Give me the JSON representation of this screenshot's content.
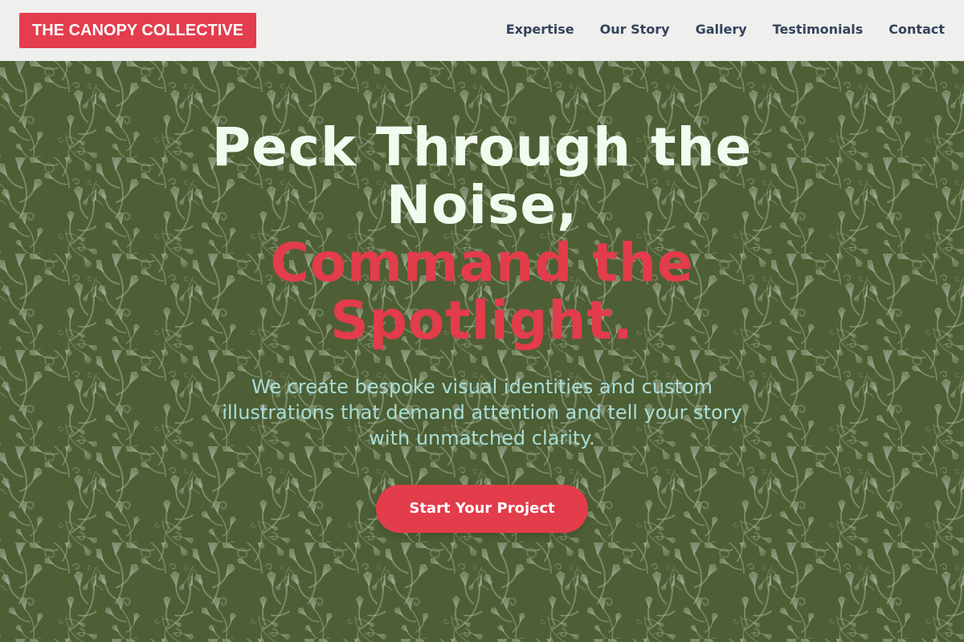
{
  "header": {
    "brand": "THE CANOPY COLLECTIVE",
    "nav": [
      "Expertise",
      "Our Story",
      "Gallery",
      "Testimonials",
      "Contact"
    ]
  },
  "hero": {
    "headline_line1": "Peck Through the",
    "headline_line2": "Noise,",
    "headline_accent_line1": "Command the",
    "headline_accent_line2": "Spotlight.",
    "subtitle": "We create bespoke visual identities and custom illustrations that demand attention and tell your story with unmatched clarity.",
    "cta_label": "Start Your Project",
    "background_icon": "fern-pattern"
  },
  "colors": {
    "accent": "#e43d4d",
    "header_bg": "#efefee",
    "nav_text": "#34435c",
    "hero_bg": "#55663a",
    "headline": "#f2fbef",
    "subtitle": "#a8ded8"
  }
}
